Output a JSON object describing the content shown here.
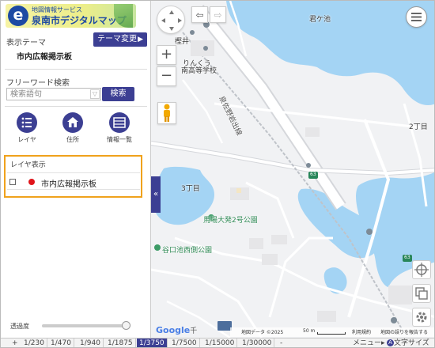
{
  "app": {
    "logo_sub": "地図情報サービス",
    "logo_main": "泉南市デジタルマップ"
  },
  "panel": {
    "theme_label": "表示テーマ",
    "theme_change_button": "テーマ変更",
    "theme_name": "市内広報掲示板",
    "freeword_label": "フリーワード検索",
    "search_placeholder": "検索語句",
    "search_button": "検索",
    "tools": [
      {
        "label": "レイヤ",
        "icon": "list-icon"
      },
      {
        "label": "住所",
        "icon": "home-icon"
      },
      {
        "label": "情報一覧",
        "icon": "table-icon"
      }
    ],
    "layer_section_title": "レイヤ表示",
    "layers": [
      {
        "name": "市内広報掲示板",
        "checked": false,
        "color": "#e0151b"
      }
    ],
    "opacity_label": "透過度",
    "opacity_value": 1.0,
    "collapse_glyph": "«"
  },
  "map": {
    "labels": {
      "pond_kimigaike": "君ケ池",
      "kashii": "樫井",
      "school_line1": "りんくう",
      "school_line2": "南高等学校",
      "road_name": "泉佐野岩出線",
      "chome2": "2丁目",
      "chome3": "3丁目",
      "route_63": "63",
      "park1": "馬場大発2号公園",
      "park2": "谷口池西側公園",
      "google": "Google",
      "google_suffix": "千"
    },
    "attribution": {
      "map_data": "地図データ ©2025",
      "scale": "50 m",
      "terms": "利用規約",
      "report": "地図の誤りを報告する"
    },
    "controls": {
      "zoom_in": "+",
      "zoom_out": "−",
      "back": "⇦",
      "forward": "⇨"
    },
    "colors": {
      "water": "#a4d4f4",
      "land": "#f1f2f4",
      "road": "#ffffff",
      "accent": "#3c3f93",
      "highlight": "#f0a21c"
    }
  },
  "scalebar": {
    "scales": [
      "1/230",
      "1/470",
      "1/940",
      "1/1875",
      "1/3750",
      "1/7500",
      "1/15000",
      "1/30000"
    ],
    "active_index": 4,
    "zoom_plus": "+",
    "zoom_minus": "-",
    "menu_link": "メニュー▸",
    "text_size_link": "文字サイズ"
  }
}
